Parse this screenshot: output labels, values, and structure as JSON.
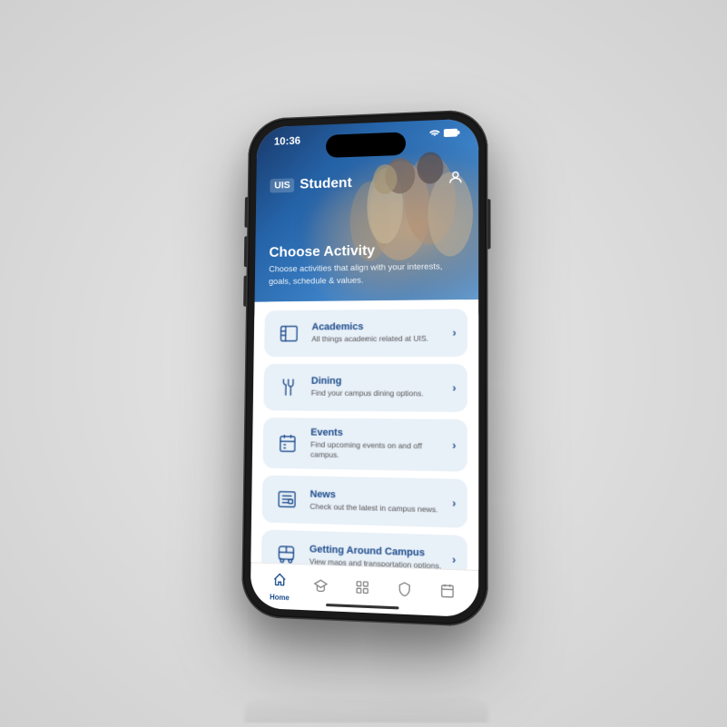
{
  "statusBar": {
    "time": "10:36",
    "icons": [
      "wifi",
      "battery"
    ]
  },
  "header": {
    "logo": "UIS",
    "title": "Student",
    "profileIcon": "person"
  },
  "hero": {
    "mainTitle": "Choose Activity",
    "subtitle": "Choose activities that align with your interests, goals, schedule & values."
  },
  "menuItems": [
    {
      "id": "academics",
      "title": "Academics",
      "description": "All things academic related at UIS.",
      "icon": "academics"
    },
    {
      "id": "dining",
      "title": "Dining",
      "description": "Find your campus dining options.",
      "icon": "dining"
    },
    {
      "id": "events",
      "title": "Events",
      "description": "Find upcoming events on and off campus.",
      "icon": "events"
    },
    {
      "id": "news",
      "title": "News",
      "description": "Check out the latest in campus news.",
      "icon": "news"
    },
    {
      "id": "getting-around",
      "title": "Getting Around Campus",
      "description": "View maps and transportation options.",
      "icon": "bus"
    }
  ],
  "bottomNav": [
    {
      "id": "home",
      "label": "Home",
      "icon": "home",
      "active": true
    },
    {
      "id": "academics-nav",
      "label": "",
      "icon": "graduation",
      "active": false
    },
    {
      "id": "apps",
      "label": "",
      "icon": "grid",
      "active": false
    },
    {
      "id": "shield",
      "label": "",
      "icon": "shield",
      "active": false
    },
    {
      "id": "calendar",
      "label": "",
      "icon": "calendar",
      "active": false
    }
  ]
}
